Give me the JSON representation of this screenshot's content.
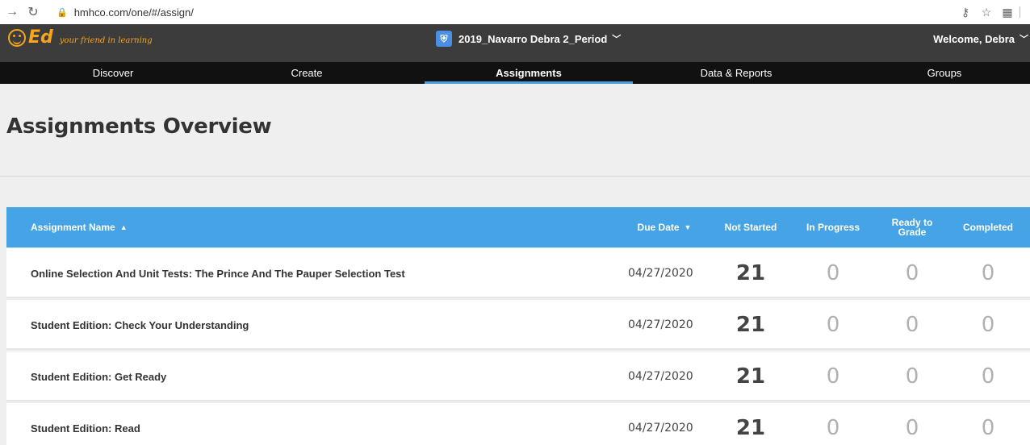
{
  "browser": {
    "url": "hmhco.com/one/#/assign/",
    "back_icon": "arrow-right-icon",
    "reload_icon": "reload-icon"
  },
  "header": {
    "logo": "Ed",
    "tagline": "your friend in learning",
    "class_name": "2019_Navarro Debra 2_Period",
    "welcome": "Welcome, Debra"
  },
  "nav": {
    "tabs": [
      {
        "label": "Discover"
      },
      {
        "label": "Create"
      },
      {
        "label": "Assignments",
        "active": true
      },
      {
        "label": "Data & Reports"
      },
      {
        "label": "Groups"
      }
    ]
  },
  "page": {
    "title": "Assignments Overview"
  },
  "table": {
    "columns": {
      "name": "Assignment Name",
      "due": "Due Date",
      "not_started": "Not Started",
      "in_progress": "In Progress",
      "ready_to_grade_1": "Ready to",
      "ready_to_grade_2": "Grade",
      "completed": "Completed"
    },
    "rows": [
      {
        "name": "Online Selection And Unit Tests: The Prince And The Pauper Selection Test",
        "due": "04/27/2020",
        "not_started": "21",
        "in_progress": "0",
        "ready": "0",
        "completed": "0"
      },
      {
        "name": "Student Edition: Check Your Understanding",
        "due": "04/27/2020",
        "not_started": "21",
        "in_progress": "0",
        "ready": "0",
        "completed": "0"
      },
      {
        "name": "Student Edition: Get Ready",
        "due": "04/27/2020",
        "not_started": "21",
        "in_progress": "0",
        "ready": "0",
        "completed": "0"
      },
      {
        "name": "Student Edition: Read",
        "due": "04/27/2020",
        "not_started": "21",
        "in_progress": "0",
        "ready": "0",
        "completed": "0"
      }
    ]
  },
  "colors": {
    "header_bg": "#3c3c3c",
    "nav_bg": "#111111",
    "accent": "#46a4e6",
    "logo": "#f7a51c"
  }
}
